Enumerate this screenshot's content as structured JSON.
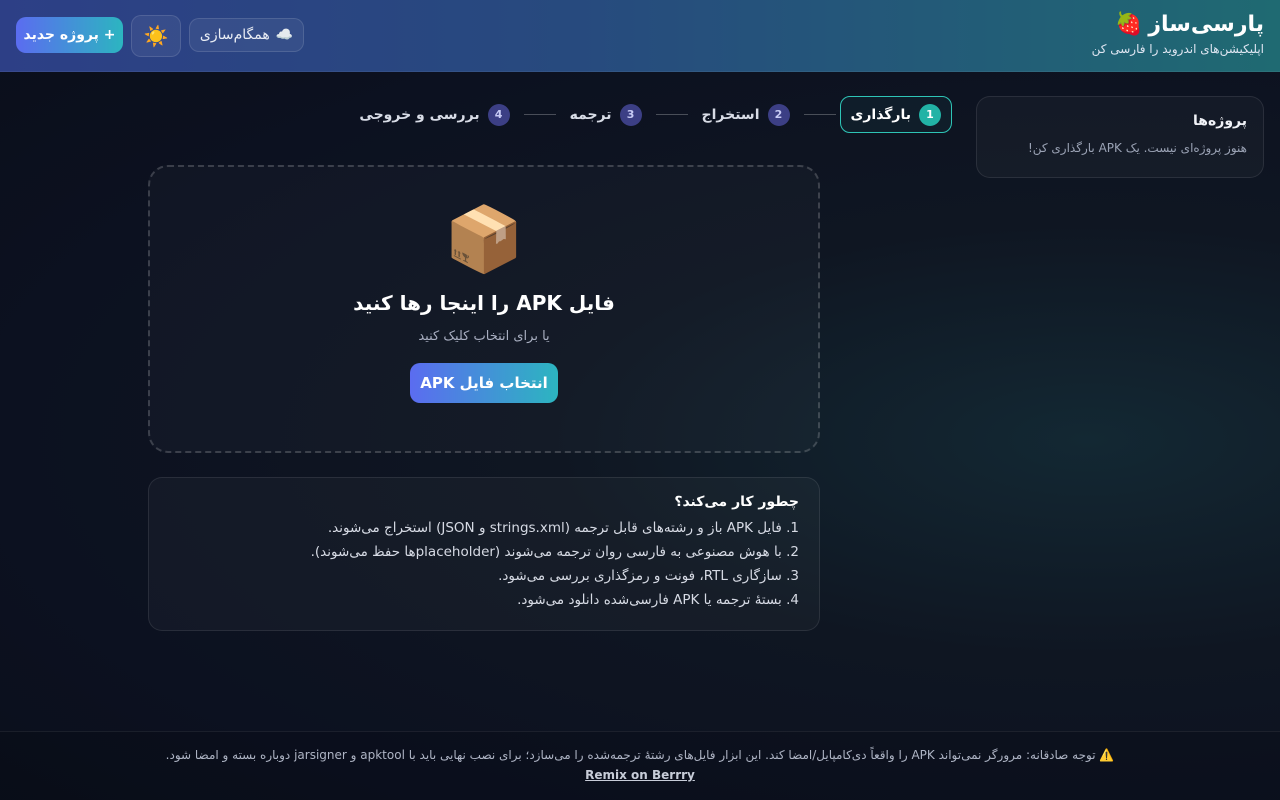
{
  "header": {
    "title": "پارسی‌ساز",
    "brand_icon": "🍓",
    "subtitle": "اپلیکیشن‌های اندروید را فارسی کن",
    "new_project_label": "+ پروژه جدید",
    "theme_icon": "☀️",
    "sync_icon": "☁️",
    "sync_label": "همگام‌سازی"
  },
  "sidebar": {
    "title": "پروژه‌ها",
    "empty_text": "هنوز پروژه‌ای نیست. یک APK بارگذاری کن!"
  },
  "steps": [
    {
      "num": "1",
      "label": "بارگذاری",
      "active": true
    },
    {
      "num": "2",
      "label": "استخراج",
      "active": false
    },
    {
      "num": "3",
      "label": "ترجمه",
      "active": false
    },
    {
      "num": "4",
      "label": "بررسی و خروجی",
      "active": false
    }
  ],
  "dropzone": {
    "icon": "📦",
    "title": "فایل APK را اینجا رها کنید",
    "subtitle": "یا برای انتخاب کلیک کنید",
    "button_label": "انتخاب فایل APK"
  },
  "how": {
    "title": "چطور کار می‌کند؟",
    "items": [
      "1. فایل APK باز و رشته‌های قابل ترجمه (strings.xml و JSON) استخراج می‌شوند.",
      "2. با هوش مصنوعی به فارسی روان ترجمه می‌شوند (placeholderها حفظ می‌شوند).",
      "3. سازگاری RTL، فونت و رمزگذاری بررسی می‌شود.",
      "4. بستهٔ ترجمه یا APK فارسی‌شده دانلود می‌شود."
    ]
  },
  "footer": {
    "note": "⚠️ توجه صادقانه: مرورگر نمی‌تواند APK را واقعاً دی‌کامپایل/امضا کند. این ابزار فایل‌های رشتهٔ ترجمه‌شده را می‌سازد؛ برای نصب نهایی باید با apktool و jarsigner دوباره بسته و امضا شود.",
    "link_label": "Remix on Berrry"
  }
}
